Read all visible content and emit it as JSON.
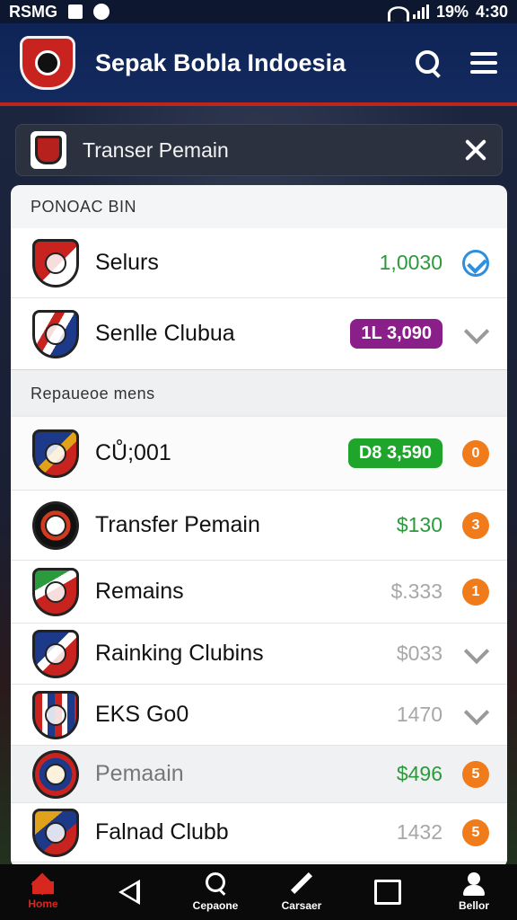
{
  "status_bar": {
    "carrier": "RSMG",
    "battery": "19%",
    "time": "4:30"
  },
  "app_bar": {
    "title": "Sepak Bobla Indoesia"
  },
  "filter": {
    "label": "Transer Pemain"
  },
  "sections": [
    {
      "header": "PONOAC BIN",
      "rows": [
        {
          "name": "Selurs",
          "value": "1,0030",
          "value_color": "#2b9a3c",
          "status": "check"
        },
        {
          "name": "Senlle Clubua",
          "pill": "1L 3,090",
          "pill_color": "#8a1f8a",
          "status": "heart"
        }
      ]
    },
    {
      "header": "Repaueoe mens",
      "rows": [
        {
          "name": "CŮ;001",
          "pill": "D8  3,590",
          "pill_color": "#1fa52c",
          "status": "badge",
          "badge_text": "0"
        },
        {
          "name": "Transfer Pemain",
          "value": "$130",
          "value_color": "#2b9a3c",
          "status": "badge",
          "badge_text": "3"
        },
        {
          "name": "Remains",
          "value": "$.333",
          "value_color": "#a7a7a7",
          "status": "badge",
          "badge_text": "1"
        },
        {
          "name": "Rainking Clubins",
          "value": "$033",
          "value_color": "#a7a7a7",
          "status": "heart"
        },
        {
          "name": "EKS Go0",
          "value": "1470",
          "value_color": "#a7a7a7",
          "status": "heart"
        },
        {
          "name": "Pemaain",
          "value": "$496",
          "value_color": "#2b9a3c",
          "status": "badge",
          "badge_text": "5"
        },
        {
          "name": "Falnad Clubb",
          "value": "1432",
          "value_color": "#a7a7a7",
          "status": "badge",
          "badge_text": "5"
        }
      ]
    }
  ],
  "bottom_nav": [
    {
      "label": "Home",
      "icon": "home-icon"
    },
    {
      "label": "",
      "icon": "back-icon"
    },
    {
      "label": "Cepaone",
      "icon": "search-icon"
    },
    {
      "label": "Carsaer",
      "icon": "pen-icon"
    },
    {
      "label": "",
      "icon": "square-icon"
    },
    {
      "label": "Bellor",
      "icon": "user-icon"
    }
  ]
}
